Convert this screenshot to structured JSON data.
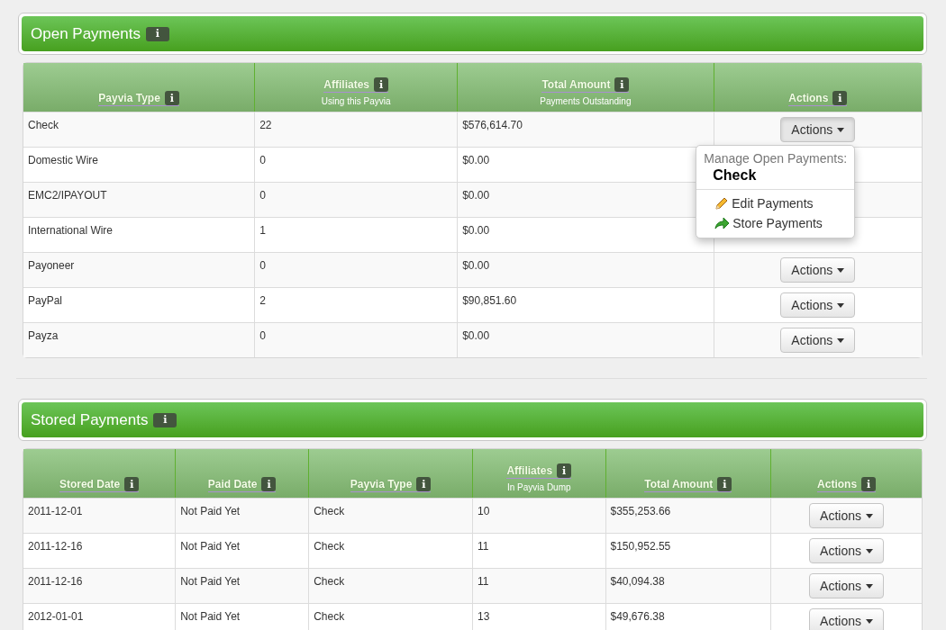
{
  "open_payments": {
    "title": "Open Payments",
    "info": "i",
    "columns": [
      {
        "title": "Payvia Type",
        "info": "i"
      },
      {
        "title": "Affiliates",
        "info": "i",
        "subtitle": "Using this Payvia"
      },
      {
        "title": "Total Amount",
        "info": "i",
        "subtitle": "Payments Outstanding"
      },
      {
        "title": "Actions",
        "info": "i"
      }
    ],
    "rows": [
      {
        "cells": [
          "Check",
          "22",
          "$576,614.70"
        ],
        "action": "Actions",
        "open": true
      },
      {
        "cells": [
          "Domestic Wire",
          "0",
          "$0.00"
        ]
      },
      {
        "cells": [
          "EMC2/IPAYOUT",
          "0",
          "$0.00"
        ]
      },
      {
        "cells": [
          "International Wire",
          "1",
          "$0.00"
        ]
      },
      {
        "cells": [
          "Payoneer",
          "0",
          "$0.00"
        ],
        "action": "Actions",
        "open": false
      },
      {
        "cells": [
          "PayPal",
          "2",
          "$90,851.60"
        ],
        "action": "Actions",
        "open": false
      },
      {
        "cells": [
          "Payza",
          "0",
          "$0.00"
        ],
        "action": "Actions",
        "open": false
      }
    ],
    "menu": {
      "heading": "Manage Open Payments:",
      "subject": "Check",
      "items": [
        {
          "label": "Edit Payments",
          "kind": "edit"
        },
        {
          "label": "Store Payments",
          "kind": "store"
        }
      ]
    }
  },
  "stored_payments": {
    "title": "Stored Payments",
    "info": "i",
    "columns": [
      {
        "title": "Stored Date",
        "info": "i"
      },
      {
        "title": "Paid Date",
        "info": "i"
      },
      {
        "title": "Payvia Type",
        "info": "i"
      },
      {
        "title": "Affiliates",
        "info": "i",
        "subtitle": "In Payvia Dump"
      },
      {
        "title": "Total Amount",
        "info": "i"
      },
      {
        "title": "Actions",
        "info": "i"
      }
    ],
    "rows": [
      {
        "cells": [
          "2011-12-01",
          "Not Paid Yet",
          "Check",
          "10",
          "$355,253.66"
        ],
        "action": "Actions",
        "open": false
      },
      {
        "cells": [
          "2011-12-16",
          "Not Paid Yet",
          "Check",
          "11",
          "$150,952.55"
        ],
        "action": "Actions",
        "open": false
      },
      {
        "cells": [
          "2011-12-16",
          "Not Paid Yet",
          "Check",
          "11",
          "$40,094.38"
        ],
        "action": "Actions",
        "open": false
      },
      {
        "cells": [
          "2012-01-01",
          "Not Paid Yet",
          "Check",
          "13",
          "$49,676.38"
        ],
        "action": "Actions",
        "open": false
      }
    ]
  }
}
